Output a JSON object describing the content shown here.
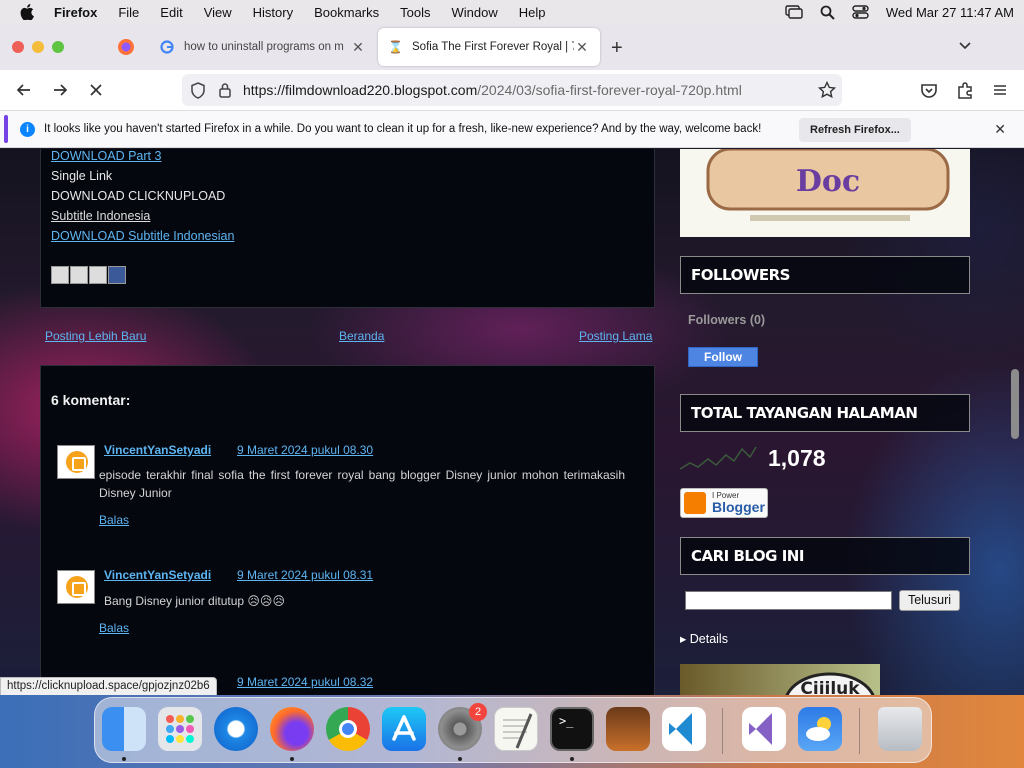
{
  "menubar": {
    "app": "Firefox",
    "items": [
      "File",
      "Edit",
      "View",
      "History",
      "Bookmarks",
      "Tools",
      "Window",
      "Help"
    ],
    "clock": "Wed Mar 27  11:47 AM"
  },
  "tabs": [
    {
      "title": "how to uninstall programs on m"
    },
    {
      "title": "Sofia The First Forever Royal | 7"
    }
  ],
  "url": {
    "host": "https://filmdownload220.blogspot.com",
    "path": "/2024/03/sofia-first-forever-royal-720p.html"
  },
  "notification": {
    "message": "It looks like you haven't started Firefox in a while. Do you want to clean it up for a fresh, like-new experience? And by the way, welcome back!",
    "button": "Refresh Firefox..."
  },
  "post": {
    "links": [
      {
        "text": "DOWNLOAD Part 3",
        "link": true
      },
      {
        "text": "Single Link",
        "link": false
      },
      {
        "text": "DOWNLOAD CLICKNUPLOAD",
        "link": false
      },
      {
        "text": "Subtitle Indonesia",
        "link": true
      },
      {
        "text": "DOWNLOAD Subtitle Indonesian",
        "link": true
      }
    ]
  },
  "pager": {
    "newer": "Posting Lebih Baru",
    "home": "Beranda",
    "older": "Posting Lama"
  },
  "comments": {
    "heading": "6 komentar:",
    "items": [
      {
        "author": "VincentYanSetyadi",
        "date": "9 Maret 2024 pukul 08.30",
        "body": "episode terakhir final sofia the first forever royal bang blogger Disney junior mohon terimakasih Disney Junior",
        "reply": "Balas"
      },
      {
        "author": "VincentYanSetyadi",
        "date": "9 Maret 2024 pukul 08.31",
        "body": "Bang Disney junior ditutup 😥😥😥",
        "reply": "Balas"
      }
    ],
    "partial_date": "9 Maret 2024 pukul 08.32"
  },
  "sidebar": {
    "followers_title": "FOLLOWERS",
    "followers_count": "Followers (0)",
    "follow_button": "Follow",
    "views_title": "TOTAL TAYANGAN HALAMAN",
    "views_count": "1,078",
    "powered_small": "I Power",
    "powered_big": "Blogger",
    "search_title": "CARI BLOG INI",
    "search_button": "Telusuri",
    "details": "▸ Details",
    "banner_text": "Ciiiluk"
  },
  "status_url": "https://clicknupload.space/gpjozjnz02b6",
  "dock": {
    "badge": "2"
  }
}
